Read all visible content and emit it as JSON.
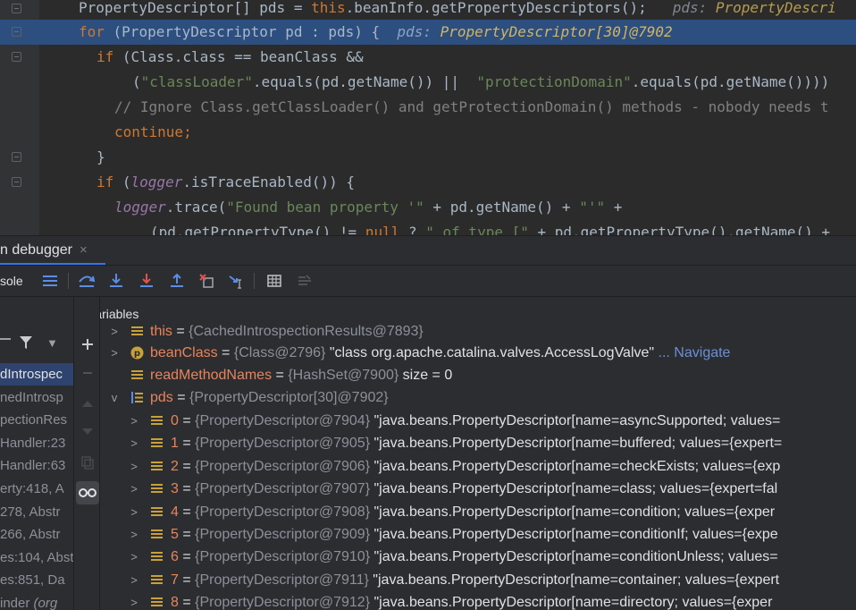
{
  "code": {
    "line1": {
      "text": "PropertyDescriptor[] pds = ",
      "this_kw": "this",
      "rest": ".beanInfo.getPropertyDescriptors();",
      "hint_label": "pds:",
      "hint_value": "PropertyDescri"
    },
    "line2": {
      "kw": "for",
      "text": " (PropertyDescriptor pd : pds) {",
      "hint_label": "pds:",
      "hint_value": "PropertyDescriptor[30]@7902"
    },
    "line3": {
      "kw": "if",
      "text": " (Class.class == beanClass &&"
    },
    "line4": {
      "open": "(",
      "str1": "\"classLoader\"",
      "mid": ".equals(pd.getName()) ||  ",
      "str2": "\"protectionDomain\"",
      "rest": ".equals(pd.getName())))"
    },
    "line5": {
      "comment": "// Ignore Class.getClassLoader() and getProtectionDomain() methods - nobody needs t"
    },
    "line6": {
      "kw": "continue;"
    },
    "line7": {
      "text": "}"
    },
    "line8": {
      "kw": "if",
      "open": " (",
      "fld": "logger",
      "rest": ".isTraceEnabled()) {"
    },
    "line9": {
      "fld": "logger",
      "mid": ".trace(",
      "str1": "\"Found bean property '\"",
      "rest": " + pd.getName() + ",
      "str2": "\"'\"",
      "end": " +"
    },
    "line10": {
      "text": "(pd.getPropertyType() != ",
      "kw": "null",
      "mid": " ? ",
      "str": "\" of type [\"",
      "rest": " + pd.getPropertyType().getName() +"
    }
  },
  "debugger": {
    "tab_label": "n debugger",
    "tab_close": "×",
    "console_label": "sole",
    "variables_title": "Variables"
  },
  "frames": [
    {
      "text": "dIntrospec",
      "selected": true
    },
    {
      "text": "nedIntrosp"
    },
    {
      "text": "pectionRes"
    },
    {
      "text": "Handler:23"
    },
    {
      "text": "Handler:63"
    },
    {
      "text": "erty:418, A"
    },
    {
      "text": "278, Abstr"
    },
    {
      "text": "266, Abstr"
    },
    {
      "text": "es:104, Abst"
    },
    {
      "text": "es:851, Da"
    },
    {
      "text": "inder ",
      "italic": "(org"
    }
  ],
  "variables": {
    "this_row": {
      "name": "this",
      "eq": " = ",
      "type": "{CachedIntrospectionResults@7893}"
    },
    "beanClass": {
      "name": "beanClass",
      "eq": " = ",
      "type": "{Class@2796}",
      "value": " \"class org.apache.catalina.valves.AccessLogValve\"",
      "nav": " ... Navigate"
    },
    "readMethodNames": {
      "name": "readMethodNames",
      "eq": " = ",
      "type": "{HashSet@7900}",
      "value": "  size = 0"
    },
    "pds": {
      "name": "pds",
      "eq": " = ",
      "type": "{PropertyDescriptor[30]@7902}"
    },
    "items": [
      {
        "name": "0",
        "eq": " = ",
        "type": "{PropertyDescriptor@7904}",
        "value": " \"java.beans.PropertyDescriptor[name=asyncSupported; values="
      },
      {
        "name": "1",
        "eq": " = ",
        "type": "{PropertyDescriptor@7905}",
        "value": " \"java.beans.PropertyDescriptor[name=buffered; values={expert="
      },
      {
        "name": "2",
        "eq": " = ",
        "type": "{PropertyDescriptor@7906}",
        "value": " \"java.beans.PropertyDescriptor[name=checkExists; values={exp"
      },
      {
        "name": "3",
        "eq": " = ",
        "type": "{PropertyDescriptor@7907}",
        "value": " \"java.beans.PropertyDescriptor[name=class; values={expert=fal"
      },
      {
        "name": "4",
        "eq": " = ",
        "type": "{PropertyDescriptor@7908}",
        "value": " \"java.beans.PropertyDescriptor[name=condition; values={exper"
      },
      {
        "name": "5",
        "eq": " = ",
        "type": "{PropertyDescriptor@7909}",
        "value": " \"java.beans.PropertyDescriptor[name=conditionIf; values={expe"
      },
      {
        "name": "6",
        "eq": " = ",
        "type": "{PropertyDescriptor@7910}",
        "value": " \"java.beans.PropertyDescriptor[name=conditionUnless; values="
      },
      {
        "name": "7",
        "eq": " = ",
        "type": "{PropertyDescriptor@7911}",
        "value": " \"java.beans.PropertyDescriptor[name=container; values={expert"
      },
      {
        "name": "8",
        "eq": " = ",
        "type": "{PropertyDescriptor@7912}",
        "value": " \"java.beans.PropertyDescriptor[name=directory; values={exper"
      }
    ]
  },
  "colors": {
    "accent": "#3574f0",
    "editor_bg": "#2b2b2b",
    "highlight_line": "#2d4f80",
    "variable_name": "#e8845c"
  }
}
